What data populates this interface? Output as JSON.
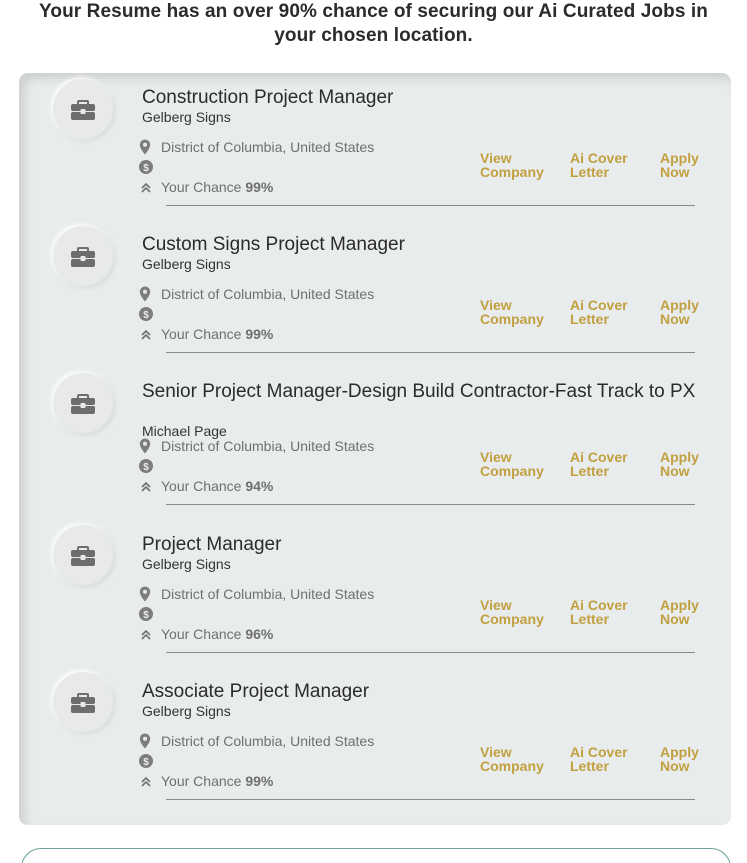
{
  "headline": {
    "line1": "Your Resume has an over 90% chance of securing our Ai Curated Jobs in",
    "line2": "your chosen location."
  },
  "icons": {
    "logo": "briefcase-icon",
    "location": "map-pin-icon",
    "salary": "dollar-icon",
    "chance": "chevron-up-double-icon"
  },
  "colors": {
    "action_gold": "#c2a040",
    "panel_bg": "#e9eced",
    "text_dark": "#2b2b2b",
    "text_muted": "#6f6f6f"
  },
  "actions": {
    "view_line1": "View",
    "view_line2": "Company",
    "cover_line1": "Ai Cover",
    "cover_line2": "Letter",
    "apply_line1": "Apply",
    "apply_line2": "Now"
  },
  "chance_label": "Your Chance ",
  "jobs": [
    {
      "title": "Construction Project Manager",
      "company": "Gelberg Signs",
      "location": "District of Columbia, United States",
      "chance": "99%"
    },
    {
      "title": "Custom Signs Project Manager",
      "company": "Gelberg Signs",
      "location": "District of Columbia, United States",
      "chance": "99%"
    },
    {
      "title": "Senior Project Manager-Design Build Contractor-Fast Track to PX",
      "company": "Michael Page",
      "location": "District of Columbia, United States",
      "chance": "94%"
    },
    {
      "title": "Project Manager",
      "company": "Gelberg Signs",
      "location": "District of Columbia, United States",
      "chance": "96%"
    },
    {
      "title": "Associate Project Manager",
      "company": "Gelberg Signs",
      "location": "District of Columbia, United States",
      "chance": "99%"
    }
  ]
}
